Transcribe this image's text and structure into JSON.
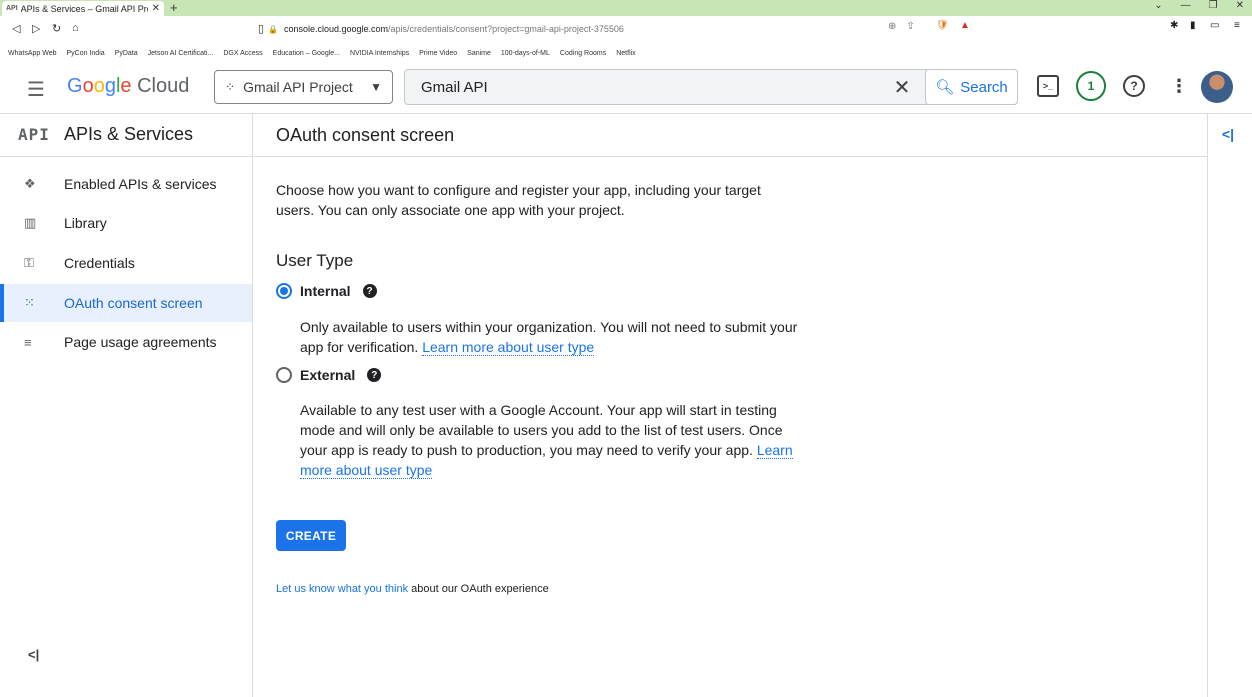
{
  "browser": {
    "tab_title": "APIs & Services – Gmail API Proje",
    "tab_favicon": "API",
    "url_host": "console.cloud.google.com",
    "url_path": "/apis/credentials/consent?project=gmail-api-project-375506",
    "bookmarks": [
      "WhatsApp Web",
      "PyCon India",
      "PyData",
      "Jetson AI Certificati...",
      "DGX Access",
      "Education – Google...",
      "NVIDIA Internships",
      "Prime Video",
      "Sanime",
      "100-days-of-ML",
      "Coding Rooms",
      "Netflix"
    ]
  },
  "header": {
    "logo_google": "Google",
    "logo_cloud": "Cloud",
    "project_name": "Gmail API Project",
    "search_value": "Gmail API",
    "search_button": "Search",
    "notification_count": "1"
  },
  "sidebar": {
    "api_badge": "API",
    "title": "APIs & Services",
    "items": [
      {
        "label": "Enabled APIs & services",
        "icon": "enabled-apis-icon"
      },
      {
        "label": "Library",
        "icon": "library-icon"
      },
      {
        "label": "Credentials",
        "icon": "key-icon"
      },
      {
        "label": "OAuth consent screen",
        "icon": "consent-icon",
        "active": true
      },
      {
        "label": "Page usage agreements",
        "icon": "agreements-icon"
      }
    ]
  },
  "main": {
    "title": "OAuth consent screen",
    "intro": "Choose how you want to configure and register your app, including your target users. You can only associate one app with your project.",
    "user_type_title": "User Type",
    "internal": {
      "label": "Internal",
      "description": "Only available to users within your organization. You will not need to submit your app for verification.",
      "link": "Learn more about user type"
    },
    "external": {
      "label": "External",
      "description": "Available to any test user with a Google Account. Your app will start in testing mode and will only be available to users you add to the list of test users. Once your app is ready to push to production, you may need to verify your app.",
      "link": "Learn more about user type"
    },
    "create_button": "CREATE",
    "feedback_link": "Let us know what you think",
    "feedback_rest": " about our OAuth experience"
  }
}
